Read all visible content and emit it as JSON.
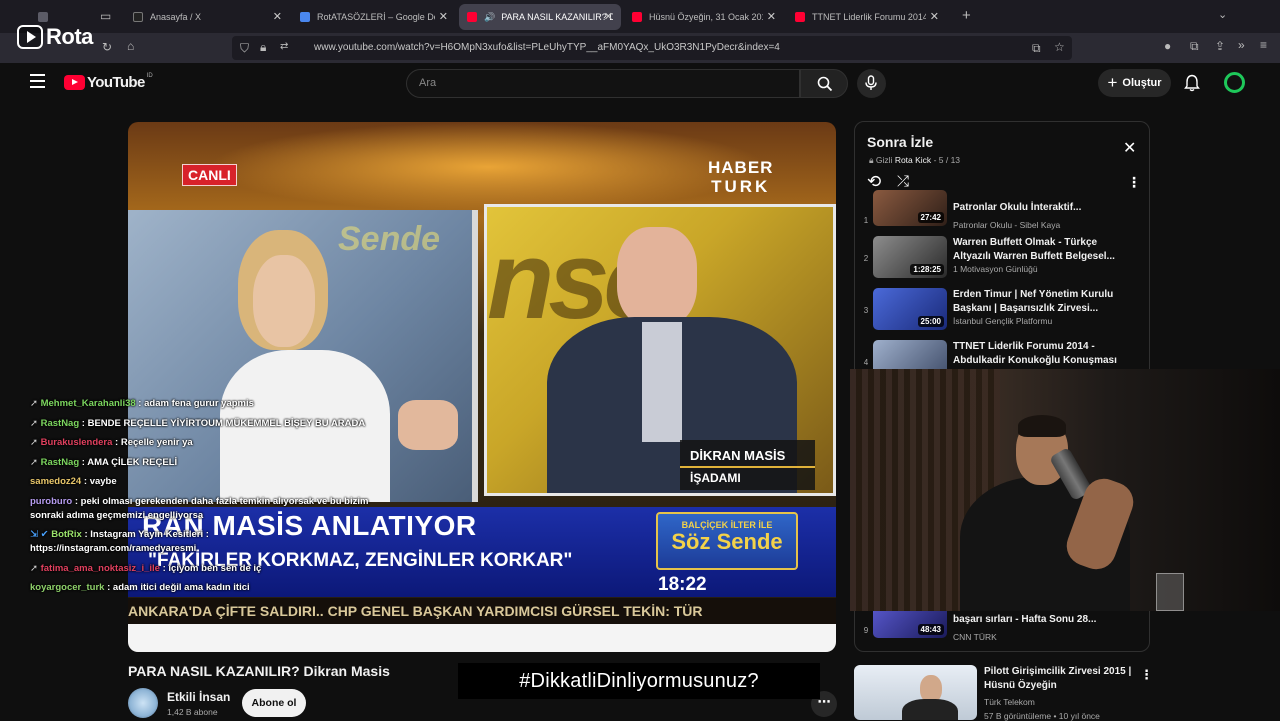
{
  "browser": {
    "tabs": [
      {
        "title": "",
        "favicon_color": "#5b5b66"
      },
      {
        "title": "Anasayfa / X",
        "favicon_color": "#000000"
      },
      {
        "title": "RotATASÖZLERİ – Google Dokü:",
        "favicon_color": "#4a87ee"
      },
      {
        "title": "PARA NASIL KAZANILIR? Di",
        "favicon_color": "#ff0033"
      },
      {
        "title": "Hüsnü Özyeğin, 31 Ocak 2017 F",
        "favicon_color": "#ff0033"
      },
      {
        "title": "TTNET Liderlik Forumu 2014 - A",
        "favicon_color": "#ff0033"
      }
    ],
    "active_tab_index": 3,
    "url": "www.youtube.com/watch?v=H6OMpN3xufo&list=PLeUhyTYP__aFM0YAQx_UkO3R3N1PyDecr&index=4"
  },
  "watermark": {
    "text": "Rota"
  },
  "youtube": {
    "logo_text": "YouTube",
    "region_badge": "ID",
    "search_placeholder": "Ara",
    "create_label": "Oluştur",
    "accent": "#ff0033"
  },
  "video": {
    "title": "PARA NASIL KAZANILIR? Dikran Masis",
    "channel": "Etkili İnsan",
    "subscribers": "1,42 B abone",
    "subscribe_label": "Abone ol",
    "overlay": {
      "live_badge": "CANLI",
      "channel_logo_top": "HABER",
      "channel_logo_bottom": "TURK",
      "guest_name": "DİKRAN MASİS",
      "guest_role": "İŞADAMI",
      "headline": "RAN MASİS ANLATIYOR",
      "quote": "\"FAKİRLER KORKMAZ, ZENGİNLER KORKAR\"",
      "program_top": "BALÇİÇEK İLTER İLE",
      "program_name": "Söz Sende",
      "clock": "18:22",
      "ticker": "ANKARA'DA ÇİFTE SALDIRI.. CHP GENEL BAŞKAN YARDIMCISI GÜRSEL TEKİN: TÜR"
    }
  },
  "chat": [
    {
      "user": "Mehmet_Karahanli38",
      "color": "#7cd65f",
      "message": "adam fena gurur yapmis"
    },
    {
      "user": "RastNag",
      "color": "#7cd65f",
      "message": "BENDE REÇELLE YİYİRTOUM MÜKEMMEL BİŞEY BU ARADA"
    },
    {
      "user": "Burakuslendera",
      "color": "#e0405e",
      "message": "Reçelle yenir ya"
    },
    {
      "user": "RastNag",
      "color": "#7cd65f",
      "message": "AMA ÇİLEK REÇELİ"
    },
    {
      "user": "samedoz24",
      "color": "#e8c66a",
      "message": "vaybe"
    },
    {
      "user": "puroburo",
      "color": "#b69cf0",
      "message": "peki olması gerekenden daha fazla temkin alıyorsak ve bu bizim sonraki adıma geçmemizi engelliyorsa"
    },
    {
      "user": "BotRix",
      "color": "#9be36b",
      "message": "Instagram Yayın Kesitleri : https://instagram.com/ramedyaresmi"
    },
    {
      "user": "fatima_ama_noktasiz_i_ile",
      "color": "#e0405e",
      "message": "içiyom ben sen de iç"
    },
    {
      "user": "koyargocer_turk",
      "color": "#8ed06a",
      "message": "adam itici değil ama kadın itici"
    }
  ],
  "up_next": {
    "heading": "Sonra İzle",
    "privacy": "Gizli",
    "playlist_name": "Rota Kick",
    "position": "5 / 13",
    "items": [
      {
        "num": "1",
        "title": "Patronlar Okulu İnteraktif...",
        "channel": "Patronlar Okulu - Sibel Kaya",
        "duration": "27:42",
        "thumb": "#5a3a30"
      },
      {
        "num": "2",
        "title": "Warren Buffett Olmak - Türkçe Altyazılı Warren Buffett Belgesel...",
        "channel": "1 Motivasyon Günlüğü",
        "duration": "1:28:25",
        "thumb": "#3d3d3d"
      },
      {
        "num": "3",
        "title": "Erden Timur | Nef Yönetim Kurulu Başkanı | Başarısızlık Zirvesi...",
        "channel": "İstanbul Gençlik Platformu",
        "duration": "25:00",
        "thumb": "#2a3fa0"
      },
      {
        "num": "4",
        "title": "TTNET Liderlik Forumu 2014 - Abdulkadir Konukoğlu Konuşması",
        "channel": "",
        "duration": "",
        "thumb": "#5a6a8a"
      },
      {
        "num": "9",
        "title": "başarı sırları - Hafta Sonu 28...",
        "channel": "CNN TÜRK",
        "duration": "48:43",
        "thumb": "#3a3a80"
      }
    ]
  },
  "recommendation": {
    "title": "Pilott Girişimcilik Zirvesi 2015 | Hüsnü Özyeğin",
    "channel": "Türk Telekom",
    "meta": "57 B görüntüleme • 10 yıl önce"
  },
  "hashtag": "#DikkatliDinliyormusunuz?"
}
